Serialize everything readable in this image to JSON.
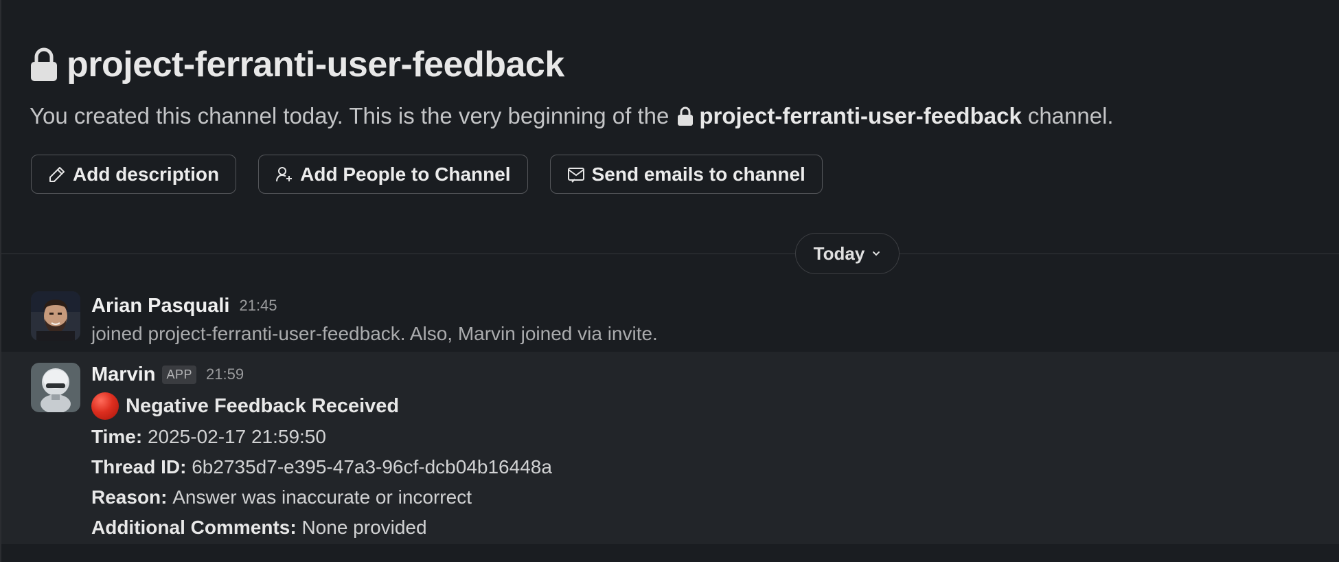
{
  "channel": {
    "name": "project-ferranti-user-feedback",
    "intro_prefix": "You created this channel today. This is the very beginning of the",
    "intro_channel": "project-ferranti-user-feedback",
    "intro_suffix": "channel."
  },
  "actions": {
    "add_description": "Add description",
    "add_people": "Add People to Channel",
    "send_emails": "Send emails to channel"
  },
  "date_divider": {
    "label": "Today"
  },
  "messages": [
    {
      "sender": "Arian Pasquali",
      "time": "21:45",
      "text": "joined project-ferranti-user-feedback. Also, Marvin joined via invite."
    },
    {
      "sender": "Marvin",
      "badge": "APP",
      "time": "21:59",
      "title": "Negative Feedback Received",
      "fields": [
        {
          "label": "Time:",
          "value": "2025-02-17 21:59:50"
        },
        {
          "label": "Thread ID:",
          "value": "6b2735d7-e395-47a3-96cf-dcb04b16448a"
        },
        {
          "label": "Reason:",
          "value": "Answer was inaccurate or incorrect"
        },
        {
          "label": "Additional Comments:",
          "value": "None provided"
        }
      ]
    }
  ],
  "icons": {
    "channel_lock": "lock-icon",
    "pencil": "pencil-icon",
    "add_person": "add-person-icon",
    "email": "email-icon",
    "chevron": "chevron-down-icon",
    "red_circle": "red-circle-emoji"
  },
  "colors": {
    "background": "#1a1d21",
    "highlight_row": "#222529",
    "red_circle": "#dd2e1f"
  }
}
